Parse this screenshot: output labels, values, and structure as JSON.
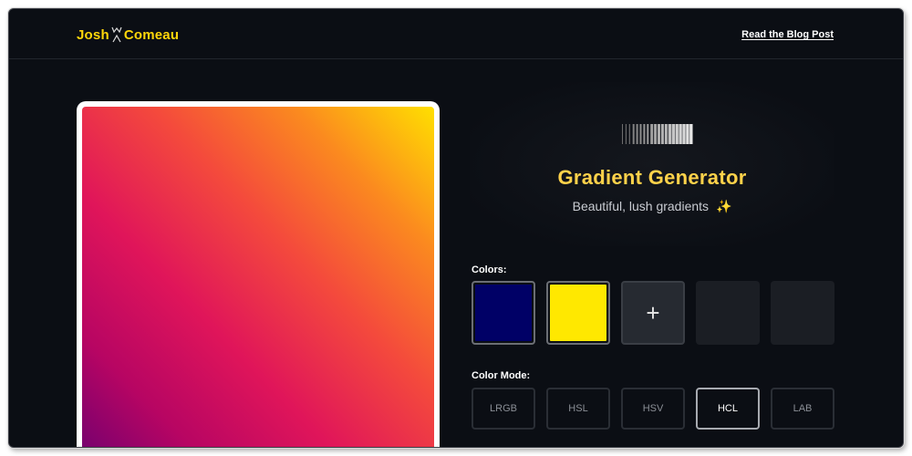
{
  "header": {
    "logo_first": "Josh",
    "logo_last": "Comeau",
    "blog_link": "Read the Blog Post"
  },
  "intro": {
    "title": "Gradient Generator",
    "subtitle": "Beautiful, lush gradients",
    "subtitle_emoji": "✨"
  },
  "colors": {
    "label": "Colors:",
    "swatches": [
      {
        "hex": "#000066"
      },
      {
        "hex": "#ffe800"
      }
    ],
    "add_symbol": "+"
  },
  "color_mode": {
    "label": "Color Mode:",
    "options": [
      "LRGB",
      "HSL",
      "HSV",
      "HCL",
      "LAB"
    ],
    "selected": "HCL"
  },
  "theme": {
    "accent": "#ffd60a",
    "background": "#0b0e14"
  }
}
